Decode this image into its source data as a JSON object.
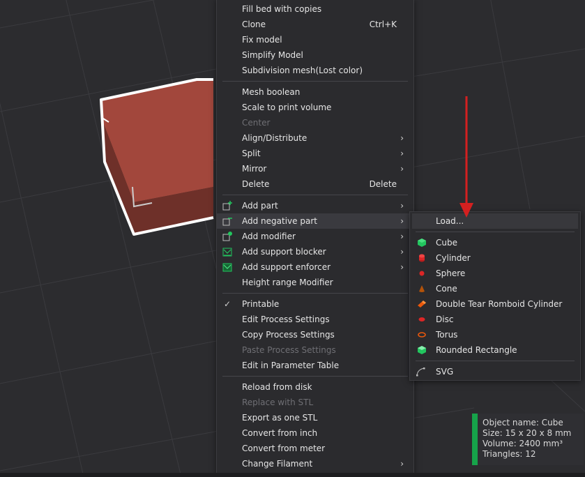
{
  "context_menu": {
    "items": [
      {
        "label": "Fill bed with copies"
      },
      {
        "label": "Clone",
        "shortcut": "Ctrl+K"
      },
      {
        "label": "Fix model"
      },
      {
        "label": "Simplify Model"
      },
      {
        "label": "Subdivision mesh(Lost color)"
      },
      {
        "label": "Mesh boolean"
      },
      {
        "label": "Scale to print volume"
      },
      {
        "label": "Center"
      },
      {
        "label": "Align/Distribute"
      },
      {
        "label": "Split"
      },
      {
        "label": "Mirror"
      },
      {
        "label": "Delete",
        "shortcut": "Delete"
      },
      {
        "label": "Add part",
        "icon": "add-part-icon"
      },
      {
        "label": "Add negative part",
        "icon": "add-negative-part-icon"
      },
      {
        "label": "Add modifier",
        "icon": "add-modifier-icon"
      },
      {
        "label": "Add support blocker",
        "icon": "support-blocker-icon"
      },
      {
        "label": "Add support enforcer",
        "icon": "support-enforcer-icon"
      },
      {
        "label": "Height range Modifier"
      },
      {
        "label": "Printable",
        "checked": true
      },
      {
        "label": "Edit Process Settings"
      },
      {
        "label": "Copy Process Settings"
      },
      {
        "label": "Paste Process Settings"
      },
      {
        "label": "Edit in Parameter Table"
      },
      {
        "label": "Reload from disk"
      },
      {
        "label": "Replace with STL"
      },
      {
        "label": "Export as one STL"
      },
      {
        "label": "Convert from inch"
      },
      {
        "label": "Convert from meter"
      },
      {
        "label": "Change Filament"
      }
    ]
  },
  "submenu": {
    "items": [
      {
        "label": "Load..."
      },
      {
        "label": "Cube",
        "icon": "cube-icon",
        "color": "#22c55e"
      },
      {
        "label": "Cylinder",
        "icon": "cylinder-icon",
        "color": "#dc2626"
      },
      {
        "label": "Sphere",
        "icon": "sphere-icon",
        "color": "#dc2626"
      },
      {
        "label": "Cone",
        "icon": "cone-icon",
        "color": "#b45309"
      },
      {
        "label": "Double Tear Romboid Cylinder",
        "icon": "romboid-cylinder-icon",
        "color": "#ea580c"
      },
      {
        "label": "Disc",
        "icon": "disc-icon",
        "color": "#dc2626"
      },
      {
        "label": "Torus",
        "icon": "torus-icon",
        "color": "#ea580c"
      },
      {
        "label": "Rounded Rectangle",
        "icon": "rounded-rectangle-icon",
        "color": "#22c55e"
      },
      {
        "label": "SVG",
        "icon": "svg-icon"
      }
    ]
  },
  "object_info": {
    "name": "Object name: Cube",
    "size": "Size: 15 x 20 x 8 mm",
    "volume": "Volume: 2400 mm³",
    "triangles": "Triangles: 12"
  },
  "colors": {
    "cube_top": "#a2473c",
    "cube_side": "#6e3029",
    "selection_outline": "#ffffff",
    "arrow": "#d42020",
    "info_accent": "#16a34a"
  }
}
